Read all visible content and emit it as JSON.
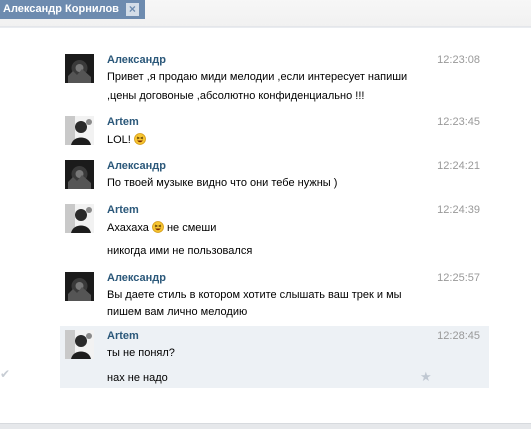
{
  "tab": {
    "title": "Александр Корнилов"
  },
  "messages": [
    {
      "author": "Александр",
      "time": "12:23:08",
      "lines": [
        "Привет ,я продаю миди мелодии ,если интересует напиши",
        ",цены договоные ,абсолютно конфиденциально !!!"
      ],
      "avatar": "dark-avatar-icon"
    },
    {
      "author": "Artem",
      "time": "12:23:45",
      "lines": [
        "LOL!"
      ],
      "avatar": "artem-avatar-icon",
      "emoji": "laughing-emoji-icon"
    },
    {
      "author": "Александр",
      "time": "12:24:21",
      "lines": [
        "По твоей музыке видно что они тебе нужны )"
      ],
      "avatar": "dark-avatar-icon"
    },
    {
      "author": "Artem",
      "time": "12:24:39",
      "lines": [
        "Ахахаха",
        "не смеши",
        "никогда ими не пользовался"
      ],
      "avatar": "artem-avatar-icon",
      "emoji": "laughing-emoji-icon"
    },
    {
      "author": "Александр",
      "time": "12:25:57",
      "lines": [
        "Вы даете стиль в котором хотите слышать ваш трек и мы",
        "пишем вам лично мелодию"
      ],
      "avatar": "dark-avatar-icon"
    },
    {
      "author": "Artem",
      "time": "12:28:45",
      "lines": [
        "ты не понял?",
        "нах не надо"
      ],
      "avatar": "artem-avatar-icon",
      "highlighted": true
    }
  ],
  "colors": {
    "tab": "#6d8baf",
    "author": "#2b587a",
    "time": "#999999",
    "highlight": "#edf1f5"
  }
}
